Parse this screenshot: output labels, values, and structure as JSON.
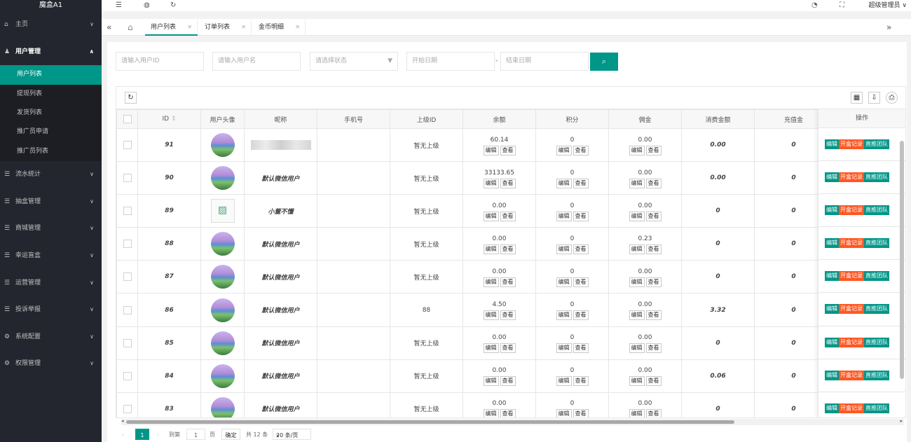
{
  "app": {
    "title": "魔盒A1",
    "user": "超级管理员"
  },
  "colors": {
    "sidebar": "#23262e",
    "accent": "#009688",
    "danger": "#ff5722"
  },
  "sidebar": [
    {
      "icon": "home-icon",
      "label": "主页",
      "glyph": "⌂",
      "chevron": "∨"
    },
    {
      "icon": "user-icon",
      "label": "用户管理",
      "glyph": "♟",
      "chevron": "∧",
      "open": true
    },
    {
      "icon": "list-icon",
      "label": "流水统计",
      "glyph": "☰",
      "chevron": "∨"
    },
    {
      "icon": "list-icon",
      "label": "抽盒管理",
      "glyph": "☰",
      "chevron": "∨"
    },
    {
      "icon": "list-icon",
      "label": "商城管理",
      "glyph": "☰",
      "chevron": "∨"
    },
    {
      "icon": "list-icon",
      "label": "幸运盲盒",
      "glyph": "☰",
      "chevron": "∨"
    },
    {
      "icon": "list-icon",
      "label": "运营管理",
      "glyph": "☰",
      "chevron": "∨"
    },
    {
      "icon": "list-icon",
      "label": "投诉举报",
      "glyph": "☰",
      "chevron": "∨"
    },
    {
      "icon": "gear-icon",
      "label": "系统配置",
      "glyph": "⚙",
      "chevron": "∨"
    },
    {
      "icon": "gear-icon",
      "label": "权限管理",
      "glyph": "⚙",
      "chevron": "∨"
    }
  ],
  "submenu": [
    "用户列表",
    "提现列表",
    "发货列表",
    "推广员申请",
    "推广员列表"
  ],
  "tabs": [
    "用户列表",
    "订单列表",
    "金币明细"
  ],
  "filters": {
    "user_id": "请输入用户ID",
    "user_name": "请输入用户名",
    "status": "请选择状态",
    "start": "开始日期",
    "end": "结束日期",
    "dash": "-"
  },
  "columns": [
    "ID",
    "用户头像",
    "昵称",
    "手机号",
    "上级ID",
    "余额",
    "积分",
    "佣金",
    "消费金额",
    "充值金",
    "操作"
  ],
  "row_buttons": {
    "edit": "编辑",
    "view": "查看"
  },
  "action_buttons": [
    "编辑",
    "开盒记录",
    "直推团队"
  ],
  "rows": [
    {
      "id": "91",
      "nick": "",
      "parent": "暂无上级",
      "balance": "60.14",
      "points": "0",
      "commission": "0.00",
      "spent": "0.00",
      "recharge": "0"
    },
    {
      "id": "90",
      "nick": "默认微信用户",
      "parent": "暂无上级",
      "balance": "33133.65",
      "points": "0",
      "commission": "0.00",
      "spent": "0.00",
      "recharge": "0"
    },
    {
      "id": "89",
      "nick": "小董不懂",
      "parent": "暂无上级",
      "balance": "0.00",
      "points": "0",
      "commission": "0.00",
      "spent": "0",
      "recharge": "0"
    },
    {
      "id": "88",
      "nick": "默认微信用户",
      "parent": "暂无上级",
      "balance": "0.00",
      "points": "0",
      "commission": "0.23",
      "spent": "0",
      "recharge": "0"
    },
    {
      "id": "87",
      "nick": "默认微信用户",
      "parent": "暂无上级",
      "balance": "0.00",
      "points": "0",
      "commission": "0.00",
      "spent": "0",
      "recharge": "0"
    },
    {
      "id": "86",
      "nick": "默认微信用户",
      "parent": "88",
      "balance": "4.50",
      "points": "0",
      "commission": "0.00",
      "spent": "3.32",
      "recharge": "0"
    },
    {
      "id": "85",
      "nick": "默认微信用户",
      "parent": "暂无上级",
      "balance": "0.00",
      "points": "0",
      "commission": "0.00",
      "spent": "0",
      "recharge": "0"
    },
    {
      "id": "84",
      "nick": "默认微信用户",
      "parent": "暂无上级",
      "balance": "0.00",
      "points": "0",
      "commission": "0.00",
      "spent": "0.06",
      "recharge": "0"
    },
    {
      "id": "83",
      "nick": "默认微信用户",
      "parent": "暂无上级",
      "balance": "0.00",
      "points": "0",
      "commission": "0.00",
      "spent": "0",
      "recharge": "0"
    }
  ],
  "pager": {
    "current": "1",
    "goto_label": "到第",
    "goto_value": "1",
    "page_unit": "页",
    "confirm": "确定",
    "total": "共 12 条",
    "size": "20 条/页"
  }
}
